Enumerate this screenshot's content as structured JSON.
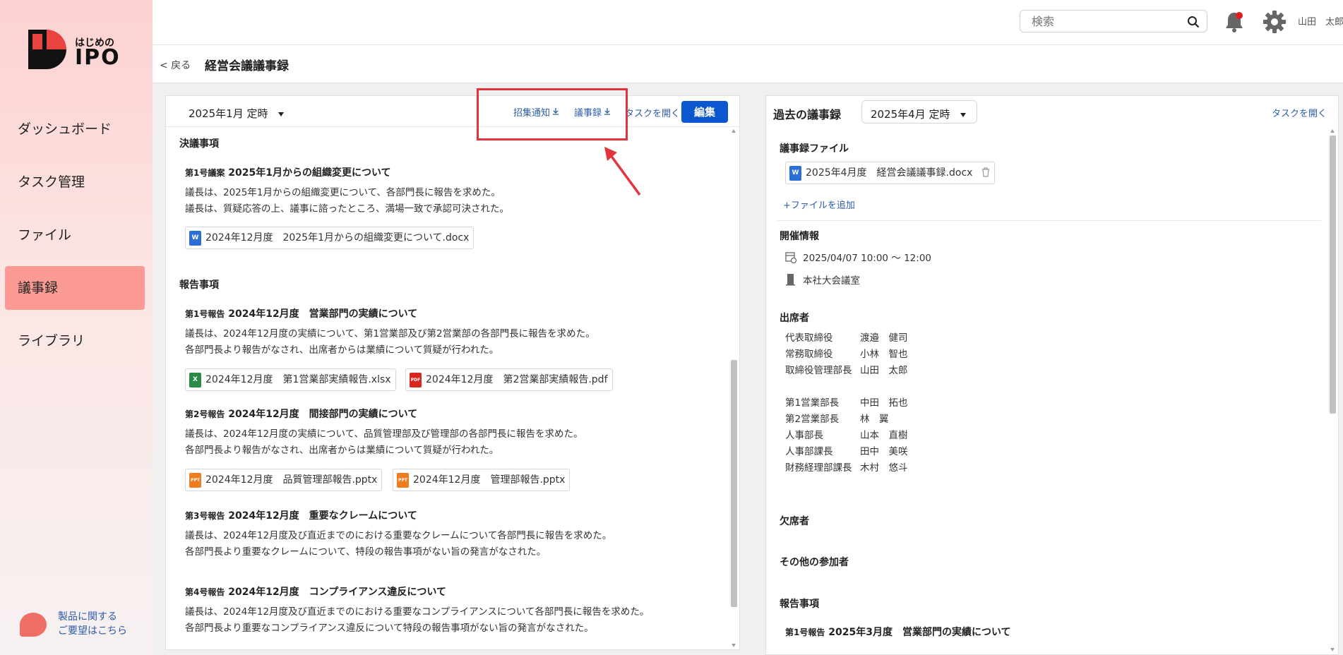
{
  "sidebar": {
    "logo_line1": "はじめの",
    "logo_line2": "IPO",
    "items": [
      {
        "label": "ダッシュボード"
      },
      {
        "label": "タスク管理"
      },
      {
        "label": "ファイル"
      },
      {
        "label": "議事録",
        "active": true
      },
      {
        "label": "ライブラリ"
      }
    ],
    "feedback_line1": "製品に関する",
    "feedback_line2": "ご要望はこちら"
  },
  "header": {
    "search_placeholder": "検索",
    "user_name": "山田　太郎"
  },
  "breadcrumb": {
    "back": "<  戻る",
    "title": "経営会議議事録"
  },
  "left": {
    "meeting_select": "2025年1月 定時",
    "links": {
      "notice": "招集通知",
      "minutes": "議事録",
      "open_tasks": "タスクを開く"
    },
    "edit_label": "編集",
    "resolutions_heading": "決議事項",
    "resolution1": {
      "prefix": "第1号議案",
      "title": "2025年1月からの組織変更について",
      "lines": [
        "議長は、2025年1月からの組織変更について、各部門長に報告を求めた。",
        "議長は、質疑応答の上、議事に諮ったところ、満場一致で承認可決された。"
      ],
      "file": "2024年12月度　2025年1月からの組織変更について.docx"
    },
    "reports_heading": "報告事項",
    "report1": {
      "prefix": "第1号報告",
      "title": "2024年12月度　営業部門の実績について",
      "lines": [
        "議長は、2024年12月度の実績について、第1営業部及び第2営業部の各部門長に報告を求めた。",
        "各部門長より報告がなされ、出席者からは業績について質疑が行われた。"
      ],
      "files": [
        "2024年12月度　第1営業部実績報告.xlsx",
        "2024年12月度　第2営業部実績報告.pdf"
      ]
    },
    "report2": {
      "prefix": "第2号報告",
      "title": "2024年12月度　間接部門の実績について",
      "lines": [
        "議長は、2024年12月度の実績について、品質管理部及び管理部の各部門長に報告を求めた。",
        "各部門長より報告がなされ、出席者からは業績について質疑が行われた。"
      ],
      "files": [
        "2024年12月度　品質管理部報告.pptx",
        "2024年12月度　管理部報告.pptx"
      ]
    },
    "report3": {
      "prefix": "第3号報告",
      "title": "2024年12月度　重要なクレームについて",
      "lines": [
        "議長は、2024年12月度及び直近までのにおける重要なクレームについて各部門長に報告を求めた。",
        "各部門長より重要なクレームについて、特段の報告事項がない旨の発言がなされた。"
      ]
    },
    "report4": {
      "prefix": "第4号報告",
      "title": "2024年12月度　コンプライアンス違反について",
      "lines": [
        "議長は、2024年12月度及び直近までのにおける重要なコンプライアンスについて各部門長に報告を求めた。",
        "各部門長より重要なコンプライアンス違反について特段の報告事項がない旨の発言がなされた。"
      ]
    }
  },
  "right": {
    "title": "過去の議事録",
    "meeting_select": "2025年4月 定時",
    "open_tasks": "タスクを開く",
    "files_heading": "議事録ファイル",
    "file": "2025年4月度　経営会議議事録.docx",
    "add_file": "+ファイルを追加",
    "info_heading": "開催情報",
    "datetime": "2025/04/07 10:00 〜 12:00",
    "location": "本社大会議室",
    "attendees_heading": "出席者",
    "attendees": [
      {
        "role": "代表取締役",
        "name": "渡邉　健司"
      },
      {
        "role": "常務取締役",
        "name": "小林　智也"
      },
      {
        "role": "取締役管理部長",
        "name": "山田　太郎"
      },
      {
        "role": "第1営業部長",
        "name": "中田　拓也"
      },
      {
        "role": "第2営業部長",
        "name": "林　翼"
      },
      {
        "role": "人事部長",
        "name": "山本　直樹"
      },
      {
        "role": "人事部課長",
        "name": "田中　美咲"
      },
      {
        "role": "財務経理部課長",
        "name": "木村　悠斗"
      }
    ],
    "absent_heading": "欠席者",
    "others_heading": "その他の参加者",
    "reports_heading": "報告事項",
    "report1_prefix": "第1号報告",
    "report1_title": "2025年3月度　営業部門の実績について"
  },
  "colors": {
    "accent": "#0b57d0",
    "link": "#2d5ca8",
    "active_nav": "#fb9b94",
    "highlight": "#e2343d"
  }
}
